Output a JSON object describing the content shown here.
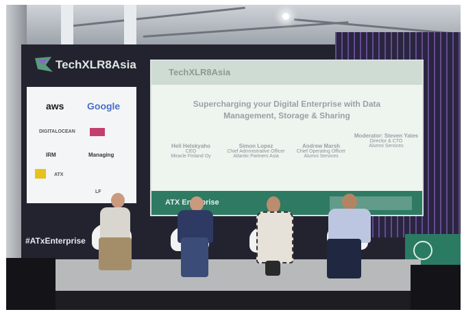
{
  "venue": {
    "brand": "TechXLR8Asia",
    "hashtag": "#ATxEnterprise",
    "sponsors": [
      "aws",
      "Google",
      "DIGITALOCEAN",
      "IRM",
      "Managing",
      "ATX",
      "LF"
    ]
  },
  "screen": {
    "brand": "TechXLR8Asia",
    "title_line1": "Supercharging your Digital Enterprise with Data",
    "title_line2": "Management, Storage & Sharing",
    "speakers": [
      {
        "name": "Heli Helskyaho",
        "role": "CEO",
        "org": "Miracle Finland Oy"
      },
      {
        "name": "Simon Lopez",
        "role": "Chief Administrative Officer",
        "org": "Atlantic Partners Asia"
      },
      {
        "name": "Andrew Marsh",
        "role": "Chief Operating Officer",
        "org": "Alumni Services"
      },
      {
        "name": "Moderator: Steven Yates",
        "role": "Director & CTO",
        "org": "Alumni Services"
      }
    ],
    "footer": "ATX Enterprise"
  },
  "colors": {
    "backdrop": "#232330",
    "screen": "#eef5ef",
    "accent_green": "#2e7a62",
    "circuit_purple": "#8a66c8"
  }
}
